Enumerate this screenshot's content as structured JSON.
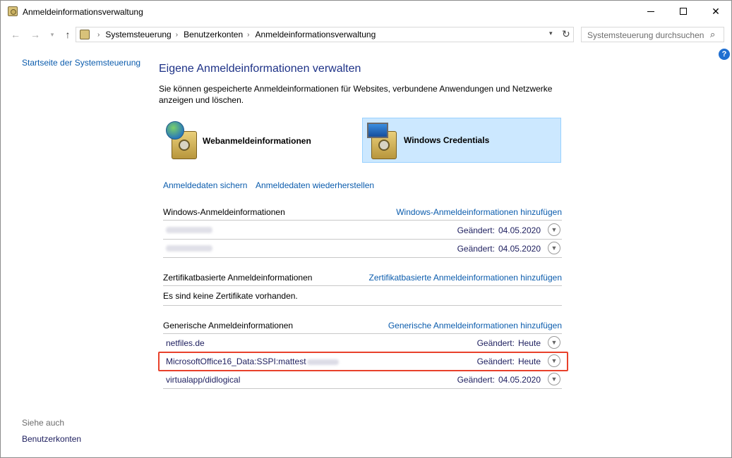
{
  "window": {
    "title": "Anmeldeinformationsverwaltung",
    "minimize_icon": "minimize-icon",
    "maximize_icon": "maximize-icon",
    "close_icon": "close-icon"
  },
  "nav": {
    "breadcrumb": [
      "Systemsteuerung",
      "Benutzerkonten",
      "Anmeldeinformationsverwaltung"
    ],
    "search_placeholder": "Systemsteuerung durchsuchen"
  },
  "sidebar": {
    "home_link": "Startseite der Systemsteuerung",
    "see_also_label": "Siehe auch",
    "see_also_link": "Benutzerkonten"
  },
  "main": {
    "heading": "Eigene Anmeldeinformationen verwalten",
    "description": "Sie können gespeicherte Anmeldeinformationen für Websites, verbundene Anwendungen und Netzwerke anzeigen und löschen.",
    "vault_web": "Webanmeldeinformationen",
    "vault_windows": "Windows Credentials",
    "backup_link": "Anmeldedaten sichern",
    "restore_link": "Anmeldedaten wiederherstellen",
    "windows_section": {
      "title": "Windows-Anmeldeinformationen",
      "add_link": "Windows-Anmeldeinformationen hinzufügen",
      "rows": [
        {
          "modified_label": "Geändert:",
          "modified_value": "04.05.2020"
        },
        {
          "modified_label": "Geändert:",
          "modified_value": "04.05.2020"
        }
      ]
    },
    "cert_section": {
      "title": "Zertifikatbasierte Anmeldeinformationen",
      "add_link": "Zertifikatbasierte Anmeldeinformationen hinzufügen",
      "empty_text": "Es sind keine Zertifikate vorhanden."
    },
    "generic_section": {
      "title": "Generische Anmeldeinformationen",
      "add_link": "Generische Anmeldeinformationen hinzufügen",
      "rows": [
        {
          "name": "netfiles.de",
          "modified_label": "Geändert:",
          "modified_value": "Heute"
        },
        {
          "name": "MicrosoftOffice16_Data:SSPI:mattest",
          "modified_label": "Geändert:",
          "modified_value": "Heute"
        },
        {
          "name": "virtualapp/didlogical",
          "modified_label": "Geändert:",
          "modified_value": "04.05.2020"
        }
      ]
    }
  },
  "colors": {
    "heading": "#1e3287",
    "link": "#0b5cad",
    "selected_vault_bg": "#cce8ff",
    "highlight_border": "#e8412b"
  }
}
